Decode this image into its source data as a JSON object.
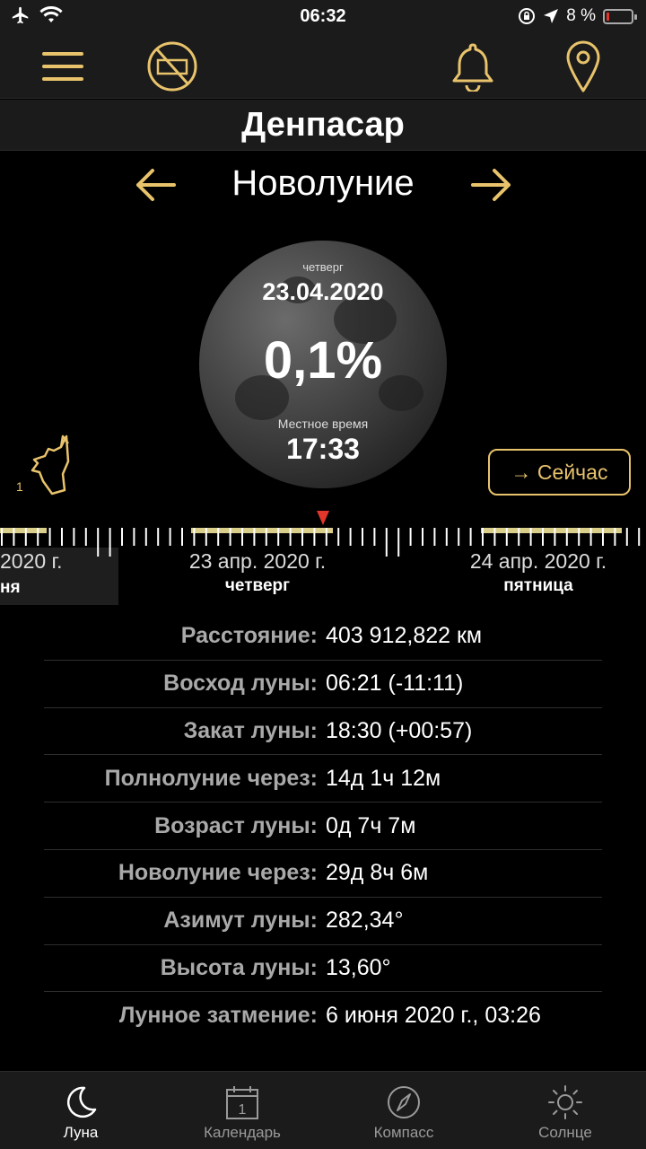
{
  "status": {
    "time": "06:32",
    "battery": "8 %"
  },
  "city": "Денпасар",
  "phase": {
    "title": "Новолуние"
  },
  "moon": {
    "weekday": "четверг",
    "date": "23.04.2020",
    "illumination": "0,1%",
    "local_time_label": "Местное время",
    "time": "17:33"
  },
  "wolf_badge": "1",
  "now_button": "→ Сейчас",
  "timeline": {
    "prev": {
      "date": "2020 г.",
      "day": "ня"
    },
    "current": {
      "date": "23 апр. 2020 г.",
      "day": "четверг"
    },
    "next": {
      "date": "24 апр. 2020 г.",
      "day": "пятница"
    }
  },
  "info": [
    {
      "label": "Расстояние:",
      "value": "403 912,822 км"
    },
    {
      "label": "Восход луны:",
      "value": "06:21 (-11:11)"
    },
    {
      "label": "Закат луны:",
      "value": "18:30 (+00:57)"
    },
    {
      "label": "Полнолуние через:",
      "value": "14д 1ч 12м"
    },
    {
      "label": "Возраст луны:",
      "value": "0д 7ч 7м"
    },
    {
      "label": "Новолуние через:",
      "value": "29д 8ч 6м"
    },
    {
      "label": "Азимут луны:",
      "value": "282,34°"
    },
    {
      "label": "Высота луны:",
      "value": "13,60°"
    },
    {
      "label": "Лунное затмение:",
      "value": "6 июня 2020 г., 03:26"
    }
  ],
  "tabs": [
    {
      "label": "Луна",
      "icon": "moon-icon",
      "active": true
    },
    {
      "label": "Календарь",
      "icon": "calendar-icon",
      "badge": "1"
    },
    {
      "label": "Компасс",
      "icon": "compass-icon"
    },
    {
      "label": "Солнце",
      "icon": "sun-icon"
    }
  ],
  "colors": {
    "accent": "#e8c36c",
    "marker": "#e0362c",
    "band": "#d9cf8a"
  }
}
